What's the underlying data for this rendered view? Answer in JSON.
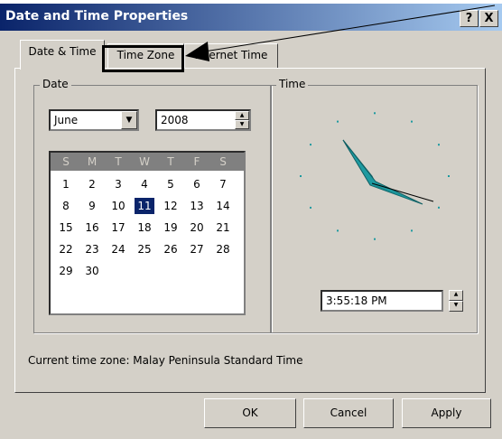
{
  "window": {
    "title": "Date and Time Properties",
    "help_glyph": "?",
    "close_glyph": "X"
  },
  "tabs": [
    {
      "label": "Date & Time",
      "active": true
    },
    {
      "label": "Time Zone",
      "active": false
    },
    {
      "label": "Internet Time",
      "active": false
    }
  ],
  "date_group": {
    "label": "Date",
    "month": "June",
    "year": "2008",
    "weekdays": [
      "S",
      "M",
      "T",
      "W",
      "T",
      "F",
      "S"
    ],
    "days": [
      [
        "1",
        "2",
        "3",
        "4",
        "5",
        "6",
        "7"
      ],
      [
        "8",
        "9",
        "10",
        "11",
        "12",
        "13",
        "14"
      ],
      [
        "15",
        "16",
        "17",
        "18",
        "19",
        "20",
        "21"
      ],
      [
        "22",
        "23",
        "24",
        "25",
        "26",
        "27",
        "28"
      ],
      [
        "29",
        "30",
        "",
        "",
        "",
        "",
        ""
      ]
    ],
    "selected_day": "11"
  },
  "time_group": {
    "label": "Time",
    "time_value": "3:55:18 PM"
  },
  "status": {
    "current_time_zone": "Current time zone:  Malay Peninsula Standard Time"
  },
  "buttons": {
    "ok": "OK",
    "cancel": "Cancel",
    "apply": "Apply"
  },
  "colors": {
    "titlebar_start": "#0a246a",
    "titlebar_end": "#a6caf0",
    "clock_hands": "#1e9aa0",
    "selection": "#0a246a"
  }
}
